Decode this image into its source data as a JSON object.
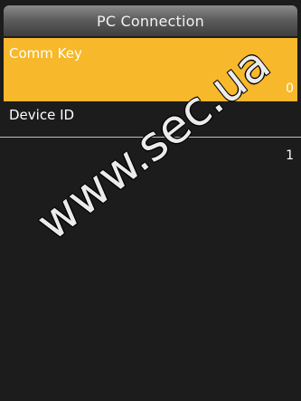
{
  "title": "PC Connection",
  "menu": {
    "items": [
      {
        "label": "Comm Key",
        "value": "0",
        "selected": true
      },
      {
        "label": "Device ID",
        "value": "1",
        "selected": false
      }
    ]
  },
  "watermark": "www.sec.ua",
  "colors": {
    "highlight": "#f7b82b",
    "background": "#1c1c1c",
    "text": "#ffffff"
  }
}
